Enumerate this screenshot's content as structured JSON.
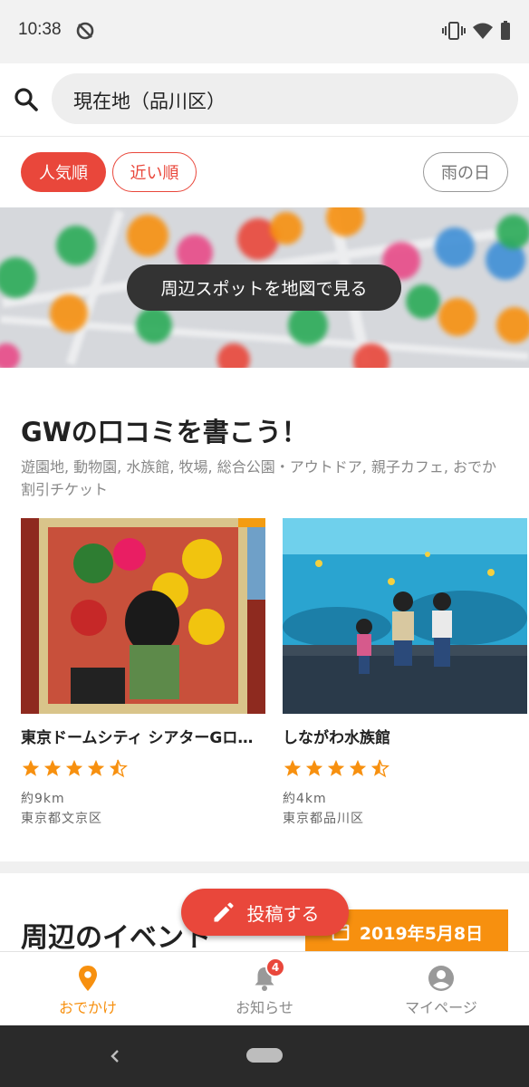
{
  "status_bar": {
    "time": "10:38",
    "icons": [
      "sync-off-icon",
      "vibrate-icon",
      "wifi-icon",
      "battery-icon"
    ]
  },
  "search": {
    "icon": "search-icon",
    "value": "現在地（品川区）"
  },
  "filters": {
    "popular": "人気順",
    "nearby": "近い順",
    "rainy_day": "雨の日",
    "active": "人気順"
  },
  "map": {
    "button_label": "周辺スポットを地図で見る"
  },
  "review_section": {
    "title": "GWの口コミを書こう！",
    "categories_line1": "遊園地, 動物園, 水族館, 牧場, 総合公園・アウトドア, 親子カフェ, おでか",
    "categories_line2": "割引チケット",
    "cards": [
      {
        "name": "東京ドームシティ シアターGロッソ",
        "rating": 4.5,
        "distance": "約9km",
        "area": "東京都文京区"
      },
      {
        "name": "しながわ水族館",
        "rating": 4.5,
        "distance": "約4km",
        "area": "東京都品川区"
      }
    ]
  },
  "events_section": {
    "title": "周辺のイベント",
    "date_label": "2019年5月8日",
    "date_icon": "calendar-icon"
  },
  "fab": {
    "label": "投稿する",
    "icon": "pencil-icon"
  },
  "bottom_nav": {
    "items": [
      {
        "label": "おでかけ",
        "icon": "location-pin-icon",
        "active": true
      },
      {
        "label": "お知らせ",
        "icon": "bell-icon",
        "badge": "4",
        "active": false
      },
      {
        "label": "マイページ",
        "icon": "account-icon",
        "active": false
      }
    ]
  },
  "colors": {
    "accent_red": "#e9473b",
    "accent_orange": "#f7900f",
    "star": "#f7900f",
    "inactive_gray": "#888888"
  }
}
